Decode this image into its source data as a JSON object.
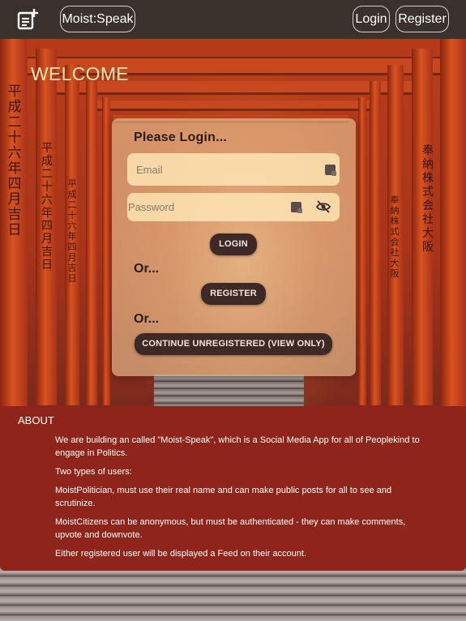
{
  "nav": {
    "new_post_icon": "note-add-icon",
    "brand": "Moist:Speak",
    "login": "Login",
    "register": "Register"
  },
  "hero": {
    "welcome": "WELCOME"
  },
  "login_card": {
    "title": "Please Login...",
    "email_placeholder": "Email",
    "password_placeholder": "Password",
    "login_button": "LOGIN",
    "or_1": "Or...",
    "register_button": "REGISTER",
    "or_2": "Or...",
    "guest_button": "CONTINUE UNREGISTERED (VIEW ONLY)",
    "icons": [
      "keyboard-icon",
      "eye-off-icon"
    ]
  },
  "about": {
    "title": "ABOUT",
    "paragraphs": [
      "We are building an called \"Moist-Speak\", which is a Social Media App for all of Peoplekind to engage in Politics.",
      "Two types of users:",
      "MoistPolitician, must use their real name and can make public posts for all to see and scrutinize.",
      "MoistCitizens can be anonymous, but must be authenticated - they can make comments, upvote and downvote.",
      "Either registered user will be displayed a Feed on their account."
    ]
  },
  "background": {
    "left_inscription": "平成二十六年四月吉日",
    "right_inscription": "奉納 株式会社 大阪",
    "colors": {
      "topbar": "#3a302c",
      "about_panel": "#8e241a",
      "welcome_text": "#fde6b0",
      "button": "#3e2926"
    }
  }
}
